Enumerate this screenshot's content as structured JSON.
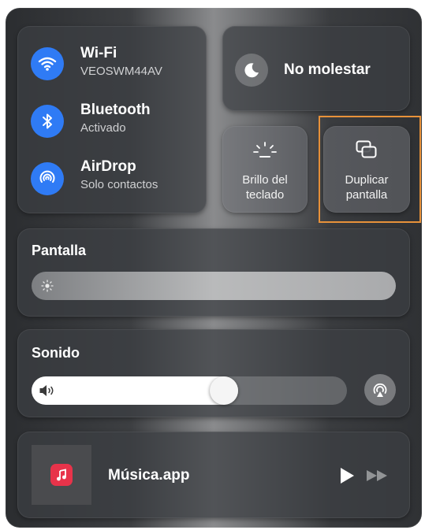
{
  "network": {
    "wifi": {
      "title": "Wi-Fi",
      "subtitle": "VEOSWM44AV"
    },
    "bluetooth": {
      "title": "Bluetooth",
      "subtitle": "Activado"
    },
    "airdrop": {
      "title": "AirDrop",
      "subtitle": "Solo contactos"
    }
  },
  "focus": {
    "label": "No molestar"
  },
  "keyboard_brightness": {
    "line1": "Brillo del",
    "line2": "teclado"
  },
  "screen_mirroring": {
    "line1": "Duplicar",
    "line2": "pantalla",
    "highlight_color": "#e8923a"
  },
  "display": {
    "title": "Pantalla",
    "brightness_level": 0.0
  },
  "sound": {
    "title": "Sonido",
    "volume_level": 0.62
  },
  "now_playing": {
    "app": "Música.app"
  },
  "colors": {
    "accent_blue": "#2f7bf5",
    "music_red": "#e8334a"
  }
}
